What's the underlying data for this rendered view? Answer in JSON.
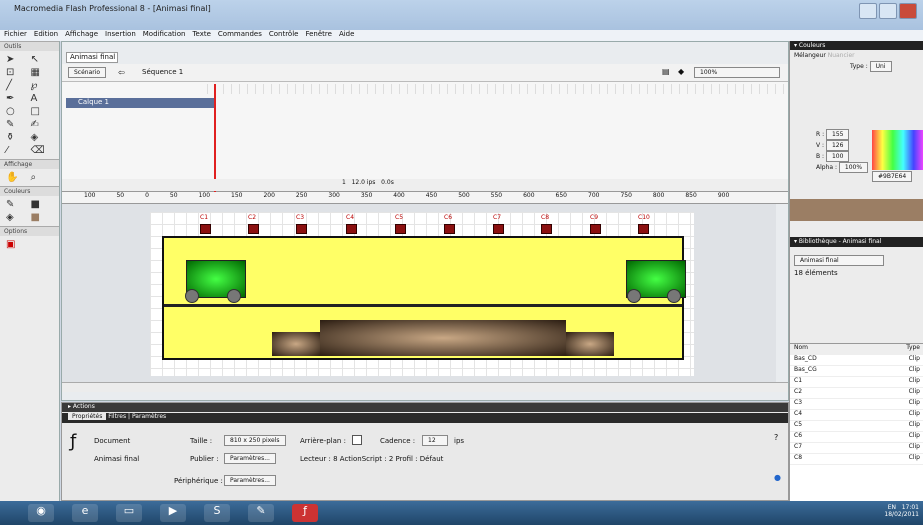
{
  "window": {
    "title": "Macromedia Flash Professional 8 - [Animasi final]"
  },
  "menu": [
    "Fichier",
    "Edition",
    "Affichage",
    "Insertion",
    "Modification",
    "Texte",
    "Commandes",
    "Contrôle",
    "Fenêtre",
    "Aide"
  ],
  "tools": {
    "label": "Outils",
    "view": "Affichage",
    "colors": "Couleurs",
    "options": "Options"
  },
  "document": {
    "tab": "Animasi final",
    "scene_btn": "Scénario",
    "scene": "Séquence 1",
    "zoom": "100%"
  },
  "timeline": {
    "layer": "Calque 1",
    "frame": "1",
    "fps": "12.0 ips",
    "time": "0.0s"
  },
  "ruler_ticks": [
    "100",
    "50",
    "0",
    "50",
    "100",
    "150",
    "200",
    "250",
    "300",
    "350",
    "400",
    "450",
    "500",
    "550",
    "600",
    "650",
    "700",
    "750",
    "800",
    "850",
    "900"
  ],
  "stage": {
    "buttons": [
      "C1",
      "C2",
      "C3",
      "C4",
      "C5",
      "C6",
      "C7",
      "C8",
      "C9",
      "C10"
    ]
  },
  "properties": {
    "actions": "Actions",
    "tabs": [
      "Propriétés",
      "Filtres",
      "Paramètres"
    ],
    "doc_label": "Document",
    "doc_name": "Animasi final",
    "size_label": "Taille :",
    "size": "810 x 250 pixels",
    "bg_label": "Arrière-plan :",
    "fps_label": "Cadence :",
    "fps": "12",
    "fps_unit": "ips",
    "publish_label": "Publier :",
    "publish_btn": "Paramètres...",
    "player": "Lecteur : 8   ActionScript : 2   Profil : Défaut",
    "device_label": "Périphérique :",
    "device_btn": "Paramètres..."
  },
  "colors_panel": {
    "title": "Couleurs",
    "tab1": "Mélangeur",
    "tab2": "Nuancier",
    "type_label": "Type :",
    "type": "Uni",
    "r_label": "R :",
    "r": "155",
    "g_label": "V :",
    "g": "126",
    "b_label": "B :",
    "b": "100",
    "alpha_label": "Alpha :",
    "alpha": "100%",
    "hex": "#9B7E64",
    "swatch_color": "#9b7e64"
  },
  "library": {
    "title": "Bibliothèque - Animasi final",
    "doc": "Animasi final",
    "count": "18 éléments",
    "col_name": "Nom",
    "col_type": "Type",
    "items": [
      {
        "name": "Bas_CD",
        "type": "Clip"
      },
      {
        "name": "Bas_CG",
        "type": "Clip"
      },
      {
        "name": "C1",
        "type": "Clip"
      },
      {
        "name": "C2",
        "type": "Clip"
      },
      {
        "name": "C3",
        "type": "Clip"
      },
      {
        "name": "C4",
        "type": "Clip"
      },
      {
        "name": "C5",
        "type": "Clip"
      },
      {
        "name": "C6",
        "type": "Clip"
      },
      {
        "name": "C7",
        "type": "Clip"
      },
      {
        "name": "C8",
        "type": "Clip"
      }
    ]
  },
  "taskbar": {
    "lang": "EN",
    "time": "17:01",
    "date": "18/02/2011"
  }
}
